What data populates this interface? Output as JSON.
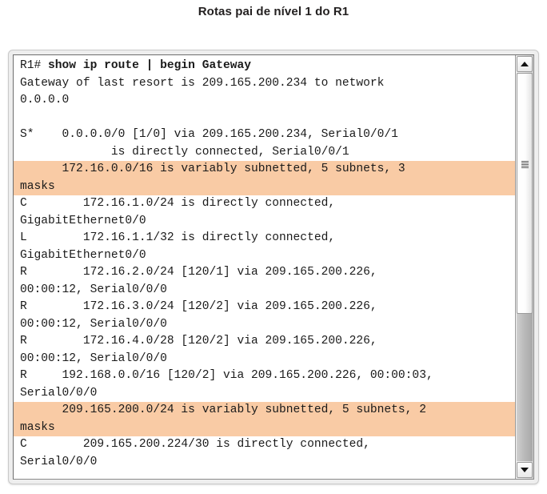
{
  "title": "Rotas pai de nível 1 do R1",
  "terminal": {
    "prompt": "R1# ",
    "command": "show ip route | begin Gateway",
    "highlight_color": "#F9CBA5",
    "lines": [
      {
        "text": "Gateway of last resort is 209.165.200.234 to network",
        "highlight": false
      },
      {
        "text": "0.0.0.0",
        "highlight": false
      },
      {
        "text": "",
        "highlight": false
      },
      {
        "text": "S*    0.0.0.0/0 [1/0] via 209.165.200.234, Serial0/0/1",
        "highlight": false
      },
      {
        "text": "             is directly connected, Serial0/0/1",
        "highlight": false
      },
      {
        "text": "      172.16.0.0/16 is variably subnetted, 5 subnets, 3",
        "highlight": true
      },
      {
        "text": "masks",
        "highlight": true
      },
      {
        "text": "C        172.16.1.0/24 is directly connected,",
        "highlight": false
      },
      {
        "text": "GigabitEthernet0/0",
        "highlight": false
      },
      {
        "text": "L        172.16.1.1/32 is directly connected,",
        "highlight": false
      },
      {
        "text": "GigabitEthernet0/0",
        "highlight": false
      },
      {
        "text": "R        172.16.2.0/24 [120/1] via 209.165.200.226,",
        "highlight": false
      },
      {
        "text": "00:00:12, Serial0/0/0",
        "highlight": false
      },
      {
        "text": "R        172.16.3.0/24 [120/2] via 209.165.200.226,",
        "highlight": false
      },
      {
        "text": "00:00:12, Serial0/0/0",
        "highlight": false
      },
      {
        "text": "R        172.16.4.0/28 [120/2] via 209.165.200.226,",
        "highlight": false
      },
      {
        "text": "00:00:12, Serial0/0/0",
        "highlight": false
      },
      {
        "text": "R     192.168.0.0/16 [120/2] via 209.165.200.226, 00:00:03,",
        "highlight": false
      },
      {
        "text": "Serial0/0/0",
        "highlight": false
      },
      {
        "text": "      209.165.200.0/24 is variably subnetted, 5 subnets, 2",
        "highlight": true
      },
      {
        "text": "masks",
        "highlight": true
      },
      {
        "text": "C        209.165.200.224/30 is directly connected,",
        "highlight": false
      },
      {
        "text": "Serial0/0/0",
        "highlight": false
      }
    ]
  },
  "scrollbar": {
    "up_arrow": "scroll-up-arrow",
    "down_arrow": "scroll-down-arrow",
    "thumb_grip": "scroll-thumb-grip"
  }
}
